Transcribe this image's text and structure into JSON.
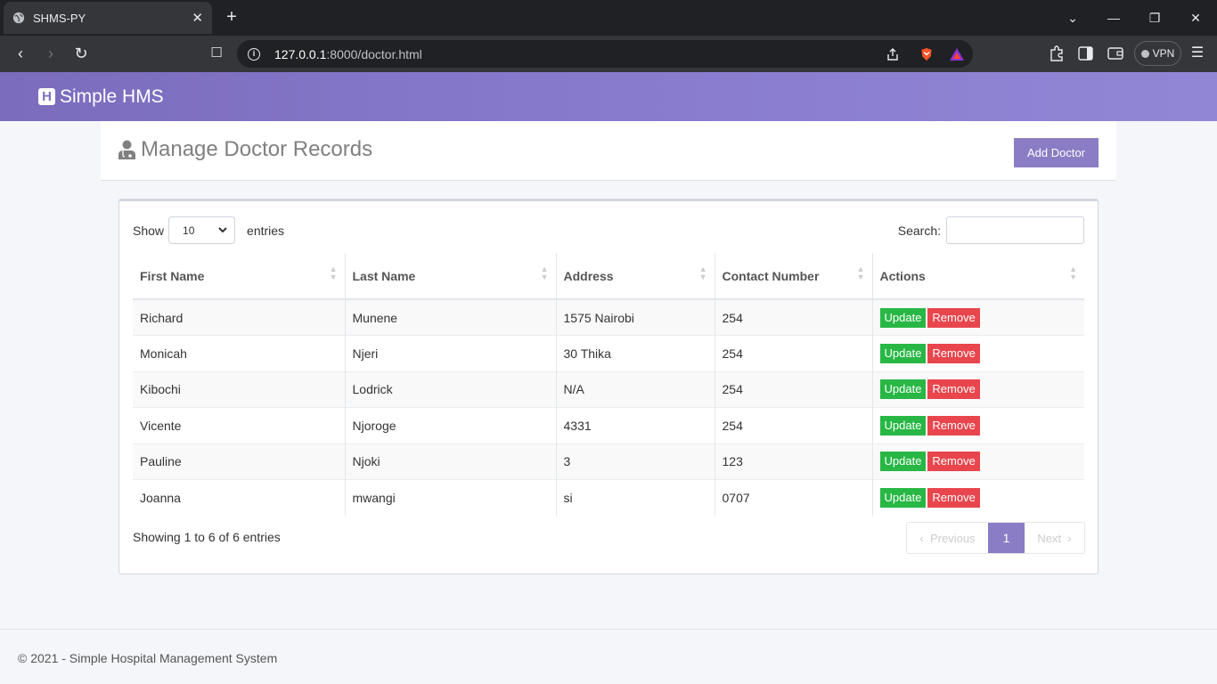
{
  "browser": {
    "tab_title": "SHMS-PY",
    "url_host": "127.0.0.1",
    "url_path": ":8000/doctor.html",
    "vpn_label": "VPN"
  },
  "app": {
    "brand_letter": "H",
    "brand_name": "Simple HMS",
    "accent": "#8a7dc5"
  },
  "page": {
    "title": "Manage Doctor Records",
    "add_button": "Add Doctor"
  },
  "datatable": {
    "show_label": "Show",
    "entries_label": "entries",
    "page_length": "10",
    "search_label": "Search:",
    "columns": [
      "First Name",
      "Last Name",
      "Address",
      "Contact Number",
      "Actions"
    ],
    "rows": [
      {
        "first": "Richard",
        "last": "Munene",
        "address": "1575 Nairobi",
        "contact": "254"
      },
      {
        "first": "Monicah",
        "last": "Njeri",
        "address": "30 Thika",
        "contact": "254"
      },
      {
        "first": "Kibochi",
        "last": "Lodrick",
        "address": "N/A",
        "contact": "254"
      },
      {
        "first": "Vicente",
        "last": "Njoroge",
        "address": "4331",
        "contact": "254"
      },
      {
        "first": "Pauline",
        "last": "Njoki",
        "address": "3",
        "contact": "123"
      },
      {
        "first": "Joanna",
        "last": "mwangi",
        "address": "si",
        "contact": "0707"
      }
    ],
    "update_label": "Update",
    "remove_label": "Remove",
    "info": "Showing 1 to 6 of 6 entries",
    "prev_label": "Previous",
    "current_page": "1",
    "next_label": "Next"
  },
  "footer": {
    "text": "© 2021 - Simple Hospital Management System"
  }
}
